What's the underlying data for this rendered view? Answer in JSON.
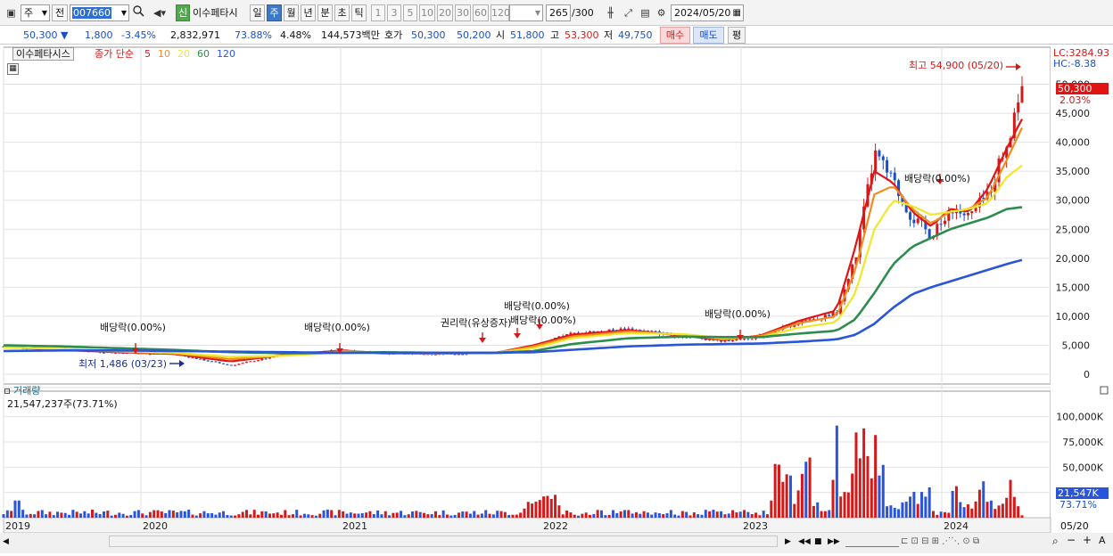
{
  "toolbar": {
    "market": "주",
    "prev_label": "전",
    "code": "007660",
    "stock_name": "이수페타시",
    "new_badge": "신",
    "periods": [
      "일",
      "주",
      "월",
      "년",
      "분",
      "초",
      "틱"
    ],
    "selected_period": "주",
    "intervals": [
      "1",
      "3",
      "5",
      "10",
      "20",
      "30",
      "60",
      "120"
    ],
    "count": "265",
    "count_total": "/300",
    "date": "2024/05/20"
  },
  "quote": {
    "price": "50,300",
    "change": "1,800",
    "change_pct": "-3.45%",
    "volume": "2,832,971",
    "vol_ratio": "73.88%",
    "turnover_pct": "4.48%",
    "amount": "144,573백만",
    "hoga_label": "호가",
    "ask": "50,300",
    "bid": "50,200",
    "open_label": "시",
    "open": "51,800",
    "high_label": "고",
    "high": "53,300",
    "low_label": "저",
    "low": "49,750",
    "buy_button": "매수",
    "sell_button": "매도",
    "eval_button": "평"
  },
  "legend": {
    "name": "이수페타시스",
    "ma_type": "종가 단순",
    "ma_periods": [
      {
        "label": "5",
        "color": "#e01414"
      },
      {
        "label": "10",
        "color": "#f08c1e"
      },
      {
        "label": "20",
        "color": "#f0e62a"
      },
      {
        "label": "60",
        "color": "#2d8c4e"
      },
      {
        "label": "120",
        "color": "#2a55d8"
      }
    ]
  },
  "right_info": {
    "lc": "LC:3284.93",
    "hc": "HC:-8.38"
  },
  "annotations": {
    "high": "최고 54,900 (05/20)",
    "low": "최저 1,486 (03/23)",
    "price_tag": "50,300",
    "price_pct": "2.03%",
    "dividends": [
      "배당락(0.00%)",
      "배당락(0.00%)",
      "권리락(유상증자)",
      "배당락(0.00%)",
      "배당락(0.00%)",
      "배당락(0.00%)",
      "배당락(0.00%)"
    ],
    "overlap_text": "배당락(0.00%)"
  },
  "volume_panel": {
    "title": "거래량",
    "value": "21,547,237주(73.71%)",
    "tag": "21,547K",
    "tag_pct": "73.71%"
  },
  "bottom": {
    "end_date": "05/20",
    "plus_label": "+",
    "font_label": "A"
  },
  "colors": {
    "up": "#d31a1a",
    "down": "#1a4fc6",
    "grid": "#d9d9d9",
    "sel": "#3f78c7"
  },
  "chart_data": {
    "type": "candlestick",
    "x_labels": [
      "2019",
      "2020",
      "2021",
      "2022",
      "2023",
      "2024"
    ],
    "price_ticks": [
      "0",
      "5,000",
      "10,000",
      "15,000",
      "20,000",
      "25,000",
      "30,000",
      "35,000",
      "40,000",
      "45,000",
      "50,000"
    ],
    "price_ylim": [
      0,
      55000
    ],
    "volume_ticks": [
      "25,000K",
      "50,000K",
      "75,000K",
      "100,000K"
    ],
    "volume_ylim": [
      0,
      120000
    ],
    "close_series": {
      "x": [
        2019.0,
        2019.3,
        2019.6,
        2019.9,
        2020.2,
        2020.5,
        2020.8,
        2021.0,
        2021.3,
        2021.6,
        2021.8,
        2022.0,
        2022.3,
        2022.6,
        2022.8,
        2023.0,
        2023.2,
        2023.4,
        2023.5,
        2023.6,
        2023.7,
        2023.8,
        2023.9,
        2024.0,
        2024.1,
        2024.2,
        2024.3,
        2024.38
      ],
      "values": [
        4800,
        4300,
        3700,
        3500,
        1500,
        3500,
        4200,
        3600,
        3500,
        3600,
        4800,
        7000,
        7800,
        6500,
        5800,
        6500,
        9000,
        10500,
        20000,
        38000,
        33000,
        27000,
        24000,
        29000,
        27000,
        31000,
        40000,
        50300
      ]
    },
    "ma_series": [
      {
        "name": "5",
        "values": [
          4700,
          4200,
          3800,
          3500,
          2200,
          3400,
          4100,
          3600,
          3550,
          3700,
          5000,
          6800,
          7600,
          6600,
          5900,
          6700,
          9200,
          11000,
          22000,
          35000,
          33000,
          28000,
          25500,
          28500,
          28000,
          32000,
          39000,
          44000
        ]
      },
      {
        "name": "10",
        "values": [
          4700,
          4300,
          3900,
          3600,
          2600,
          3300,
          4000,
          3700,
          3600,
          3700,
          4800,
          6500,
          7400,
          6800,
          6000,
          6600,
          8800,
          10000,
          18000,
          31000,
          32500,
          28500,
          26000,
          28000,
          28500,
          30500,
          37000,
          42500
        ]
      },
      {
        "name": "20",
        "values": [
          4600,
          4400,
          4000,
          3700,
          3000,
          3200,
          3800,
          3700,
          3600,
          3700,
          4500,
          6200,
          7100,
          6900,
          6200,
          6400,
          8000,
          9000,
          14000,
          25000,
          30000,
          29000,
          27500,
          28000,
          28500,
          29500,
          34000,
          36000
        ]
      },
      {
        "name": "60",
        "values": [
          5000,
          4800,
          4500,
          4200,
          3800,
          3600,
          3700,
          3800,
          3700,
          3700,
          4000,
          5200,
          6200,
          6500,
          6400,
          6400,
          7000,
          7500,
          9500,
          14000,
          19000,
          22000,
          23500,
          25000,
          26000,
          27000,
          28500,
          28800
        ]
      },
      {
        "name": "120",
        "values": [
          4000,
          4100,
          4100,
          4000,
          3900,
          3800,
          3700,
          3700,
          3700,
          3700,
          3800,
          4200,
          4800,
          5100,
          5200,
          5300,
          5600,
          6000,
          6800,
          8700,
          11500,
          13800,
          15000,
          16000,
          17000,
          18000,
          19000,
          19700
        ]
      }
    ]
  }
}
